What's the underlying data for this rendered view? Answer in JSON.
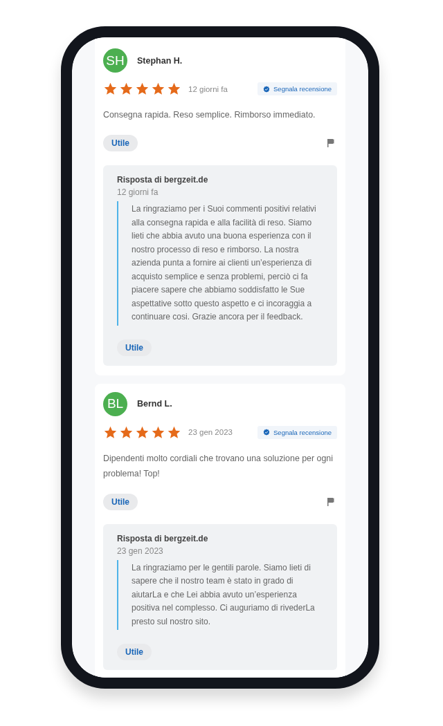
{
  "reviews": [
    {
      "initials": "SH",
      "name": "Stephan H.",
      "stars": 5,
      "date": "12 giorni fa",
      "report": "Segnala recensione",
      "text": "Consegna rapida. Reso semplice. Rimborso immediato.",
      "helpful": "Utile",
      "reply": {
        "title": "Risposta di bergzeit.de",
        "date": "12 giorni fa",
        "text": "La ringraziamo per i Suoi commenti positivi relativi alla consegna rapida e alla facilità di reso. Siamo lieti che abbia avuto una buona esperienza con il nostro processo di reso e rimborso. La nostra azienda punta a fornire ai clienti un’esperienza di acquisto semplice e senza problemi, perciò ci fa piacere sapere che abbiamo soddisfatto le Sue aspettative sotto questo aspetto e ci incoraggia a continuare cosi. Grazie ancora per il feedback.",
        "helpful": "Utile"
      }
    },
    {
      "initials": "BL",
      "name": "Bernd L.",
      "stars": 5,
      "date": "23 gen 2023",
      "report": "Segnala recensione",
      "text": "Dipendenti molto cordiali che trovano una soluzione per ogni problema! Top!",
      "helpful": "Utile",
      "reply": {
        "title": "Risposta di bergzeit.de",
        "date": "23 gen 2023",
        "text": "La ringraziamo per le gentili parole. Siamo lieti di sapere che il nostro team è stato in grado di aiutarLa e che Lei abbia avuto un’esperienza positiva nel complesso. Ci auguriamo di rivederLa presto sul nostro sito.",
        "helpful": "Utile"
      }
    }
  ]
}
